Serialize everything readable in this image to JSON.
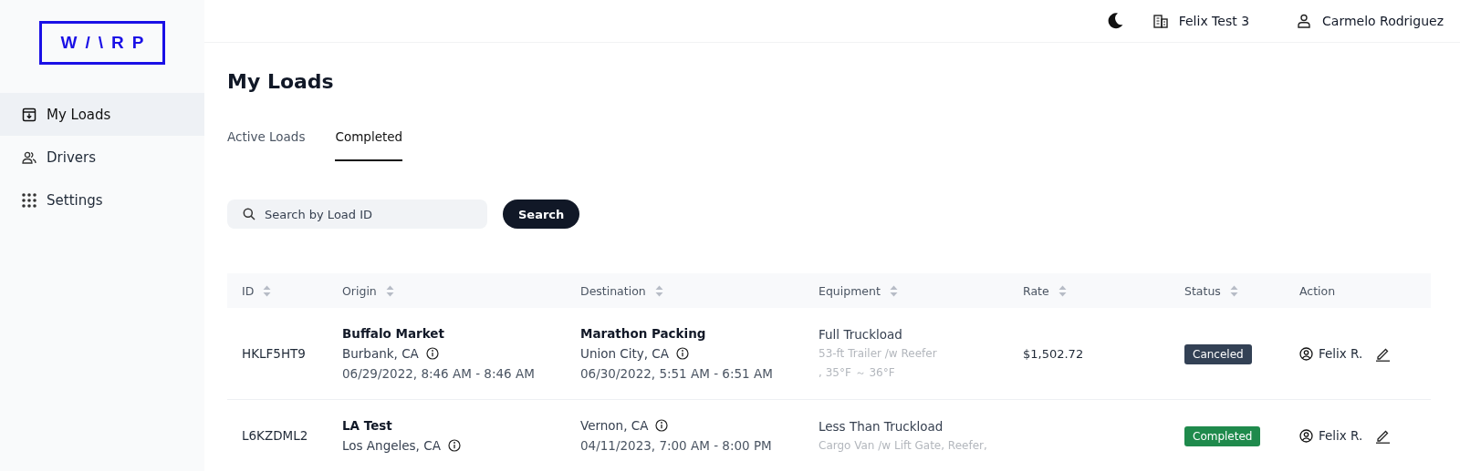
{
  "logo": {
    "text": "W/\\RP"
  },
  "sidebar": {
    "items": [
      {
        "label": "My Loads",
        "selected": true
      },
      {
        "label": "Drivers",
        "selected": false
      },
      {
        "label": "Settings",
        "selected": false
      }
    ]
  },
  "topbar": {
    "company": "Felix Test 3",
    "user": "Carmelo Rodriguez"
  },
  "page_title": "My Loads",
  "tabs": [
    {
      "label": "Active Loads",
      "selected": false
    },
    {
      "label": "Completed",
      "selected": true
    }
  ],
  "search": {
    "placeholder": "Search by Load ID",
    "button": "Search"
  },
  "table": {
    "columns": [
      {
        "label": "ID",
        "sortable": true
      },
      {
        "label": "Origin",
        "sortable": true
      },
      {
        "label": "Destination",
        "sortable": true
      },
      {
        "label": "Equipment",
        "sortable": true
      },
      {
        "label": "Rate",
        "sortable": true
      },
      {
        "label": "Status",
        "sortable": true
      },
      {
        "label": "Action",
        "sortable": false
      }
    ],
    "rows": [
      {
        "id": "HKLF5HT9",
        "origin": {
          "name": "Buffalo Market",
          "city": "Burbank, CA",
          "time": "06/29/2022, 8:46 AM - 8:46 AM"
        },
        "destination": {
          "name": "Marathon Packing",
          "city": "Union City, CA",
          "time": "06/30/2022, 5:51 AM - 6:51 AM"
        },
        "equipment": {
          "type": "Full Truckload",
          "details": [
            "53-ft Trailer /w Reefer",
            ", 35°F ～ 36°F"
          ]
        },
        "rate": "$1,502.72",
        "status": {
          "label": "Canceled",
          "color": "#334155"
        },
        "driver": "Felix R."
      },
      {
        "id": "L6KZDML2",
        "origin": {
          "name": "LA Test",
          "city": "Los Angeles, CA"
        },
        "destination": {
          "city": "Vernon, CA",
          "time": "04/11/2023, 7:00 AM - 8:00 PM"
        },
        "equipment": {
          "type": "Less Than Truckload",
          "details": [
            "Cargo Van /w Lift Gate, Reefer,"
          ]
        },
        "status": {
          "label": "Completed",
          "color": "#1f8a4c"
        },
        "driver": "Felix R."
      }
    ]
  }
}
